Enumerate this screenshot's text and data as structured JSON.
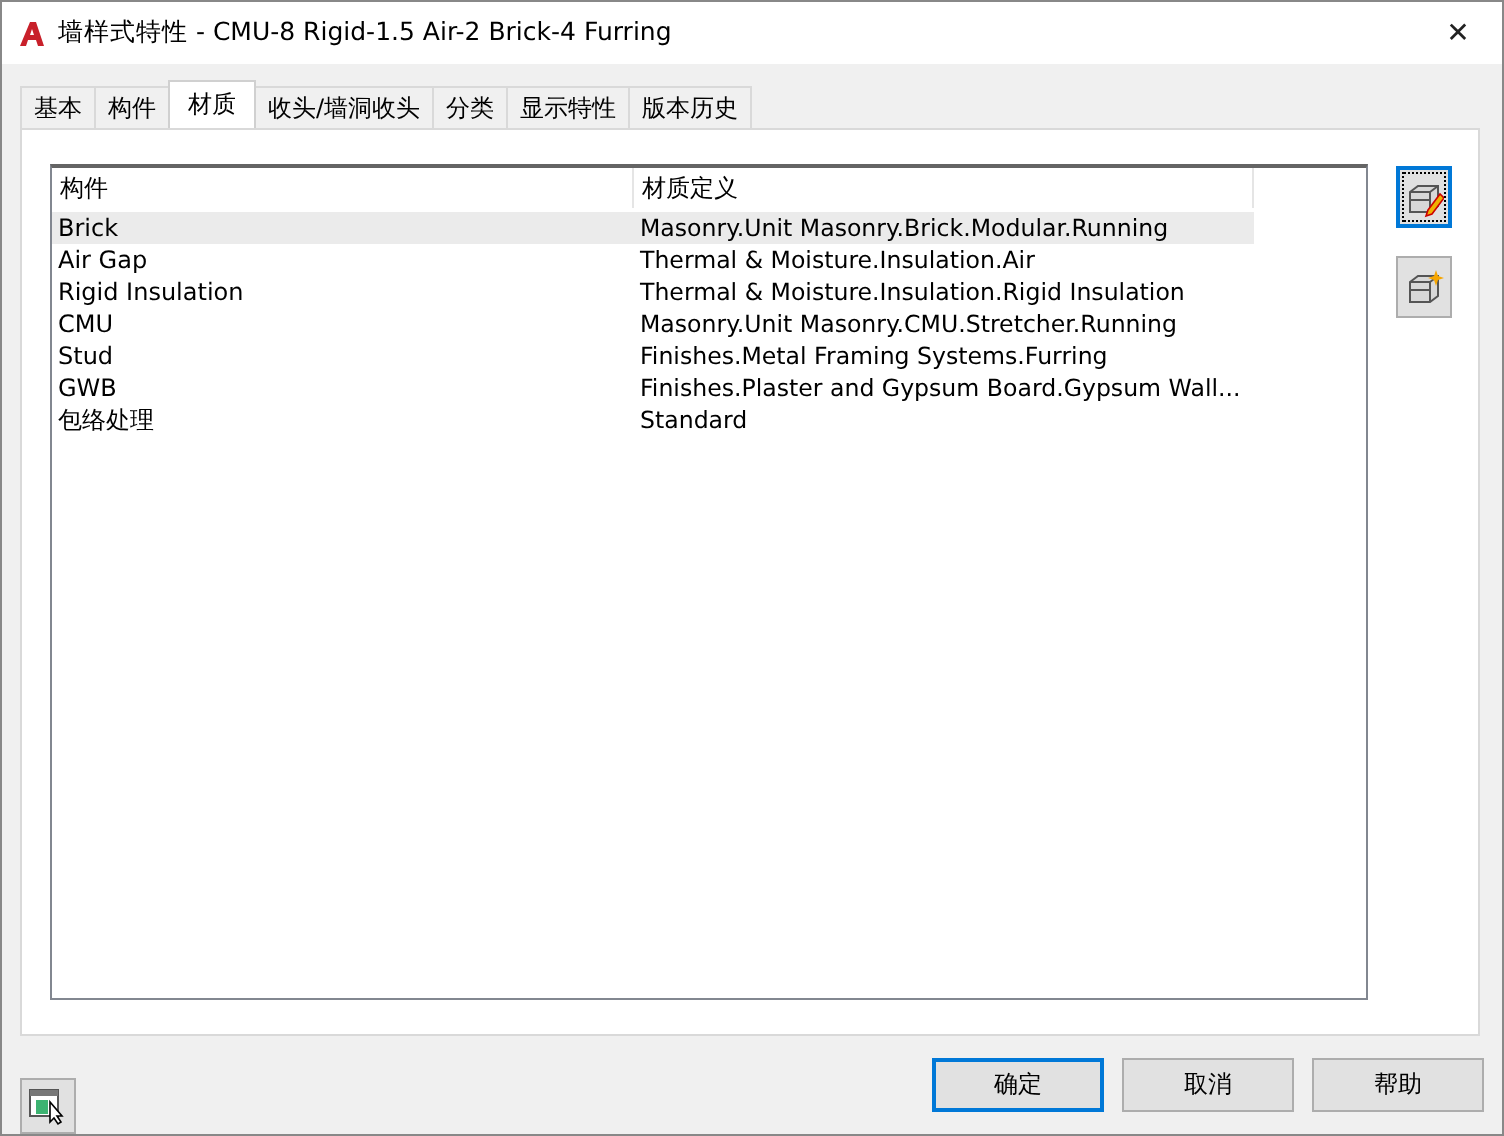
{
  "window": {
    "title": "墙样式特性 - CMU-8 Rigid-1.5 Air-2 Brick-4 Furring",
    "close": "✕"
  },
  "tabs": [
    {
      "label": "基本",
      "selected": false
    },
    {
      "label": "构件",
      "selected": false
    },
    {
      "label": "材质",
      "selected": true
    },
    {
      "label": "收头/墙洞收头",
      "selected": false
    },
    {
      "label": "分类",
      "selected": false
    },
    {
      "label": "显示特性",
      "selected": false
    },
    {
      "label": "版本历史",
      "selected": false
    }
  ],
  "table": {
    "columns": [
      "构件",
      "材质定义"
    ],
    "rows": [
      {
        "component": "Brick",
        "material": "Masonry.Unit Masonry.Brick.Modular.Running",
        "selected": true
      },
      {
        "component": "Air Gap",
        "material": "Thermal & Moisture.Insulation.Air",
        "selected": false
      },
      {
        "component": "Rigid Insulation",
        "material": "Thermal & Moisture.Insulation.Rigid Insulation",
        "selected": false
      },
      {
        "component": "CMU",
        "material": "Masonry.Unit Masonry.CMU.Stretcher.Running",
        "selected": false
      },
      {
        "component": "Stud",
        "material": "Finishes.Metal Framing Systems.Furring",
        "selected": false
      },
      {
        "component": "GWB",
        "material": "Finishes.Plaster and Gypsum Board.Gypsum Wall...",
        "selected": false
      },
      {
        "component": "包络处理",
        "material": "Standard",
        "selected": false
      }
    ]
  },
  "side_tools": [
    {
      "kind": "edit",
      "focused": true
    },
    {
      "kind": "new",
      "focused": false
    }
  ],
  "buttons": [
    {
      "label": "确定",
      "focused": true
    },
    {
      "label": "取消",
      "focused": false
    },
    {
      "label": "帮助",
      "focused": false
    }
  ]
}
